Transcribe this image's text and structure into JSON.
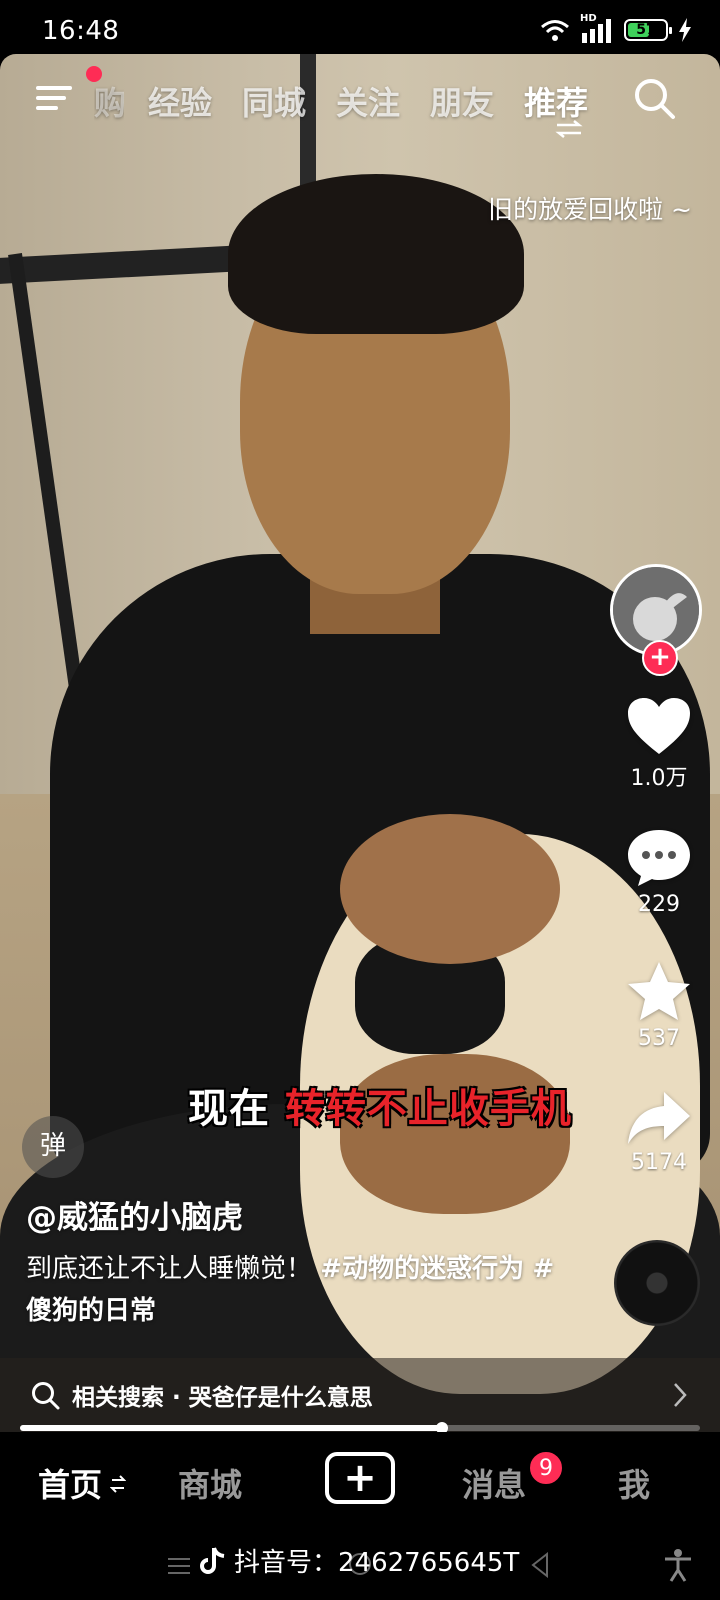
{
  "status_bar": {
    "time": "16:48",
    "network": "HD",
    "battery": "57",
    "battery_level": 0.57
  },
  "top_nav": {
    "partial_tab": "购",
    "tabs": [
      {
        "label": "经验"
      },
      {
        "label": "同城"
      },
      {
        "label": "关注"
      },
      {
        "label": "朋友"
      },
      {
        "label": "推荐"
      }
    ]
  },
  "overlay_caption": "旧的放爱回收啦 ~",
  "actions": {
    "likes": "1.0万",
    "comments": "229",
    "favorites": "537",
    "shares": "5174"
  },
  "danmaku_label": "弹",
  "subtitle": {
    "white": "现在",
    "red": "转转不止收手机"
  },
  "author": "@威猛的小脑虎",
  "description": {
    "text": "到底还让不让人睡懒觉！",
    "tags": [
      "#动物的迷惑行为",
      "#傻狗的日常"
    ]
  },
  "related_search": {
    "text": "相关搜索 · 哭爸仔是什么意思"
  },
  "progress": 0.62,
  "bottom_nav": {
    "home": "首页",
    "mall": "商城",
    "create": "+",
    "messages": "消息",
    "messages_badge": "9",
    "me": "我"
  },
  "tiktok_id": "抖音号：2462765645T",
  "colors": {
    "accent": "#fe2c55",
    "subtitle_red": "#e8232a",
    "battery_green": "#3fd15b"
  }
}
